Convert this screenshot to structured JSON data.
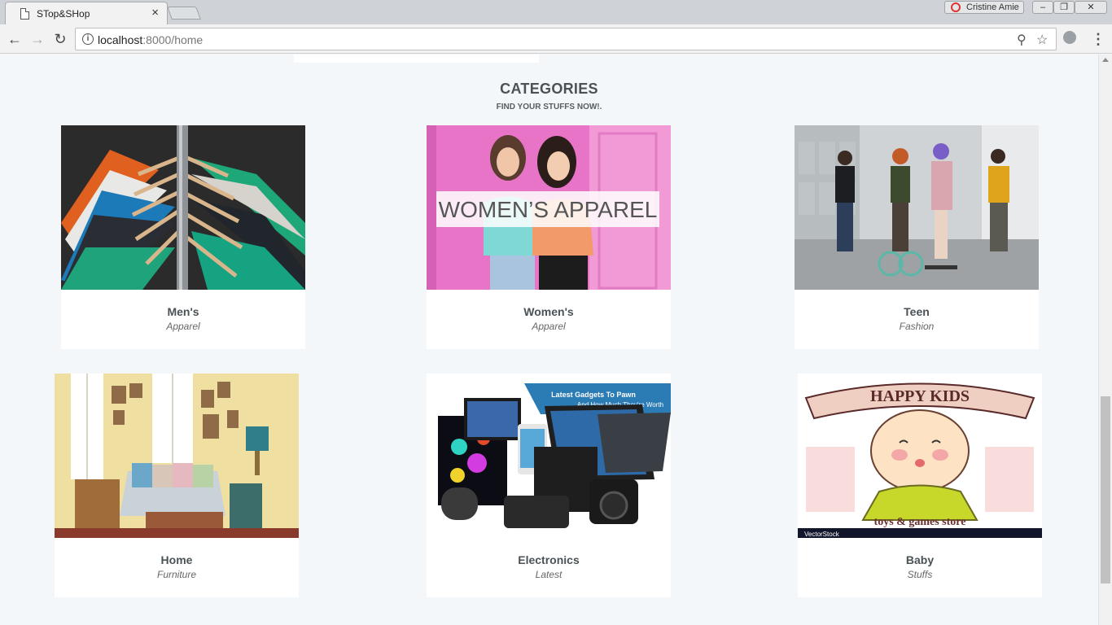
{
  "browser": {
    "tab_title": "STop&SHop",
    "profile_name": "Cristine Amie",
    "url_host": "localhost",
    "url_path": ":8000/home",
    "window_buttons": [
      "–",
      "❐",
      "✕"
    ]
  },
  "page": {
    "categories_title": "CATEGORIES",
    "categories_subtitle": "FIND YOUR STUFFS NOW!.",
    "cards": [
      {
        "name": "Men's",
        "tag": "Apparel"
      },
      {
        "name": "Women's",
        "tag": "Apparel",
        "banner_text": "WOMEN’S APPAREL"
      },
      {
        "name": "Teen",
        "tag": "Fashion"
      },
      {
        "name": "Home",
        "tag": "Furniture"
      },
      {
        "name": "Electronics",
        "tag": "Latest",
        "banner_title": "Latest Gadgets To Pawn",
        "banner_sub": "And How Much They're Worth"
      },
      {
        "name": "Baby",
        "tag": "Stuffs",
        "banner_title": "HAPPY KIDS",
        "banner_sub": "toys & games store",
        "watermark": "VectorStock"
      }
    ]
  },
  "colors": {
    "page_bg": "#f4f7fa",
    "heading": "#4a5256",
    "card_bg": "#ffffff"
  }
}
